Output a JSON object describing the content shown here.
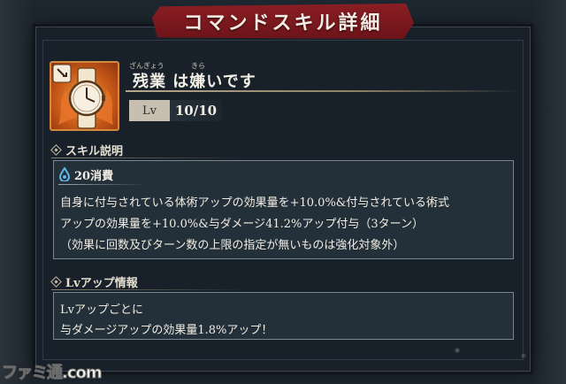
{
  "title": "コマンドスキル詳細",
  "skill": {
    "ruby_1": "ざんぎょう",
    "ruby_2": "きら",
    "name": "残業 は嫌いです",
    "lv_label": "Lv",
    "lv_value": "10/10"
  },
  "description_section": {
    "header": "スキル説明",
    "cost": "20消費",
    "lines": [
      "自身に付与されている体術アップの効果量を+10.0%&付与されている術式",
      "アップの効果量を+10.0%&与ダメージ41.2%アップ付与（3ターン）",
      "（効果に回数及びターン数の上限の指定が無いものは強化対象外）"
    ]
  },
  "lvup_section": {
    "header": "Lvアップ情報",
    "lines": [
      "Lvアップごとに",
      "与ダメージアップの効果量1.8%アップ！"
    ]
  },
  "watermark": "ファミ通.com",
  "icons": {
    "skill_icon": "wristwatch-on-flame-icon",
    "cost_icon": "cursed-energy-drop-icon",
    "section_marker": "diamond-icon"
  },
  "colors": {
    "title_banner": "#7a1a1f",
    "panel_bg": "#182129",
    "box_bg": "#243039",
    "skill_icon_bg": "#d9782a"
  }
}
